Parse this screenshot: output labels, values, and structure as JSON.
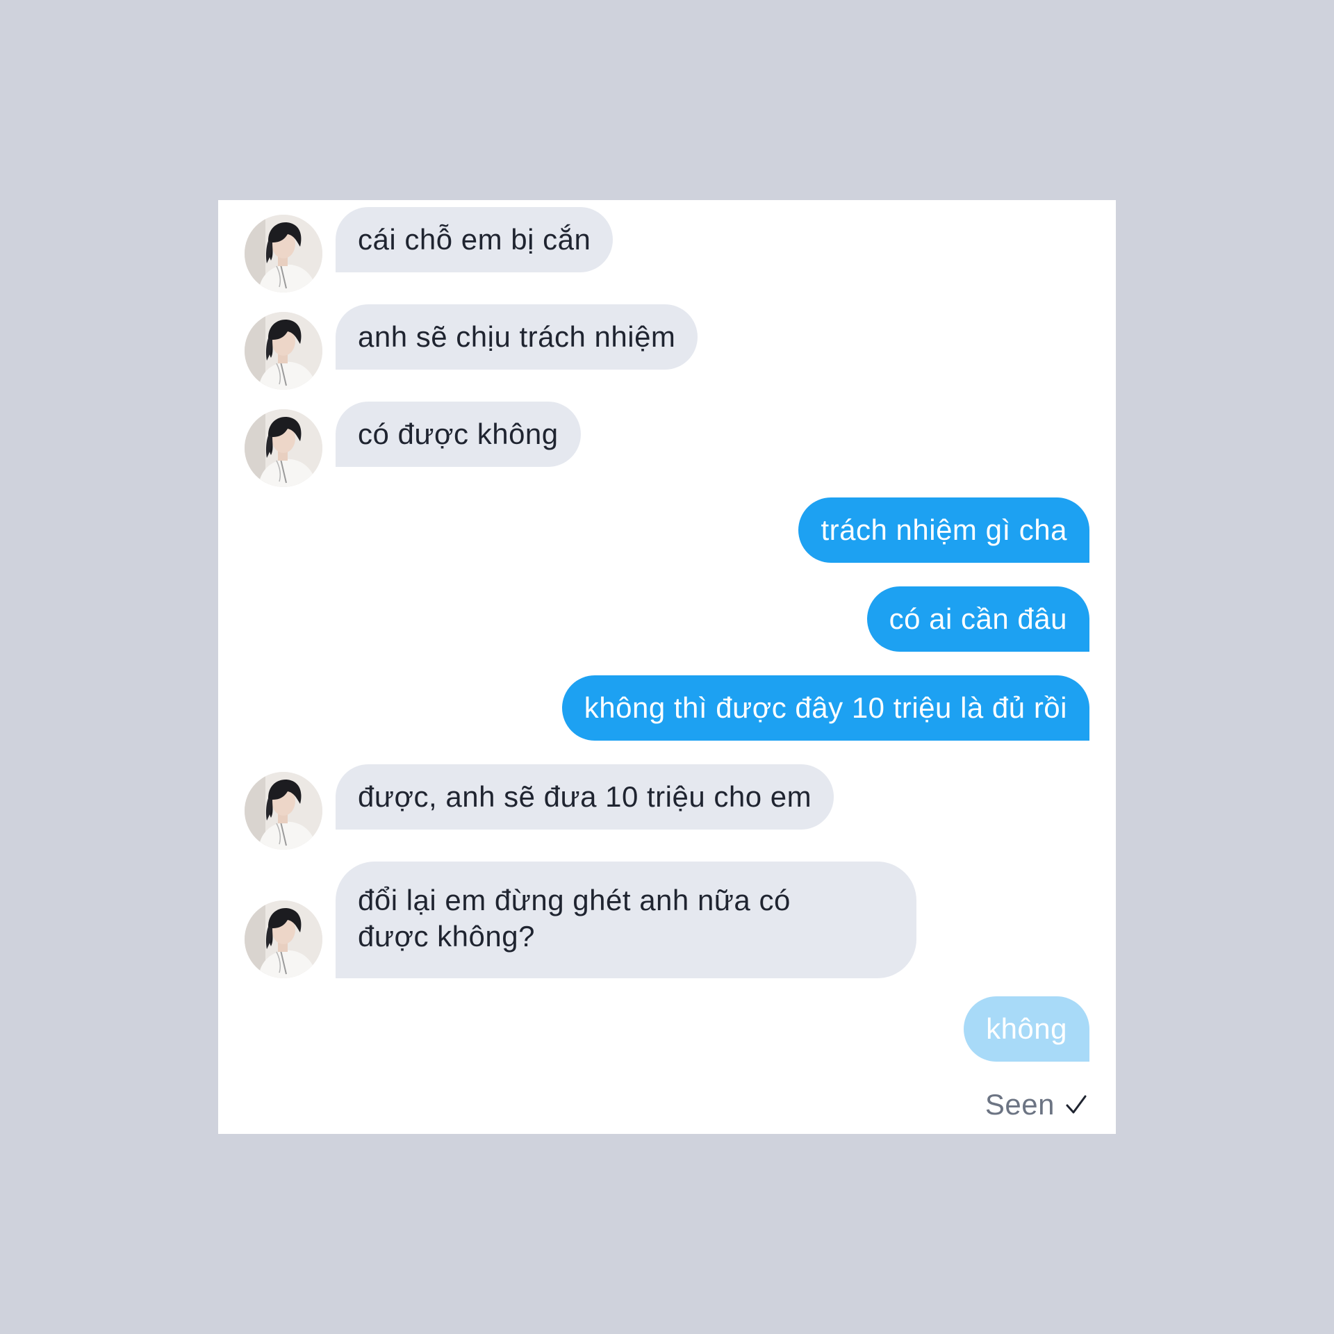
{
  "conversation": {
    "messages": [
      {
        "direction": "incoming",
        "text": "cái chỗ em bị cắn",
        "avatar": "profile-photo"
      },
      {
        "direction": "incoming",
        "text": "anh sẽ chịu trách nhiệm",
        "avatar": "profile-photo"
      },
      {
        "direction": "incoming",
        "text": "có được không",
        "avatar": "profile-photo"
      },
      {
        "direction": "outgoing",
        "text": "trách nhiệm gì cha"
      },
      {
        "direction": "outgoing",
        "text": "có ai cần đâu"
      },
      {
        "direction": "outgoing",
        "text": "không thì được đây 10 triệu là đủ rồi"
      },
      {
        "direction": "incoming",
        "text": "được, anh sẽ đưa 10 triệu cho em",
        "avatar": "profile-photo"
      },
      {
        "direction": "incoming",
        "text_line1": "đổi lại em đừng ghét anh nữa có",
        "text_line2": "được không?",
        "avatar": "profile-photo"
      },
      {
        "direction": "outgoing",
        "text": "không",
        "state": "sending"
      }
    ],
    "status": {
      "label": "Seen",
      "icon": "checkmark-icon"
    }
  },
  "colors": {
    "page_background": "#cfd2dc",
    "card_background": "#ffffff",
    "incoming_bubble": "#e5e8ef",
    "outgoing_bubble": "#1da1f2",
    "outgoing_bubble_pending": "#a8daf8",
    "status_text": "#6c7483"
  }
}
